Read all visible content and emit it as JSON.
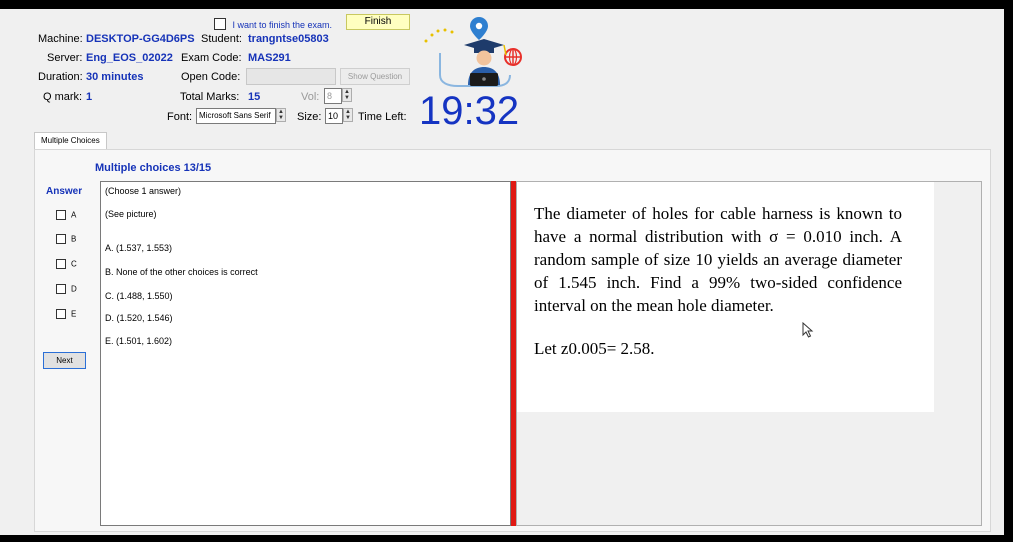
{
  "header": {
    "finish_checkbox_label": "I want to finish the exam.",
    "finish_button": "Finish",
    "machine_label": "Machine:",
    "machine_value": "DESKTOP-GG4D6PS",
    "student_label": "Student:",
    "student_value": "trangntse05803",
    "server_label": "Server:",
    "server_value": "Eng_EOS_02022",
    "exam_code_label": "Exam Code:",
    "exam_code_value": "MAS291",
    "duration_label": "Duration:",
    "duration_value": "30 minutes",
    "open_code_label": "Open Code:",
    "open_code_value": "",
    "show_question_button": "Show Question",
    "qmark_label": "Q mark:",
    "qmark_value": "1",
    "total_marks_label": "Total Marks:",
    "total_marks_value": "15",
    "vol_label": "Vol:",
    "vol_value": "8",
    "font_label": "Font:",
    "font_value": "Microsoft Sans Serif",
    "size_label": "Size:",
    "size_value": "10",
    "time_left_label": "Time Left:",
    "time_left_value": "19:32"
  },
  "tabs": {
    "active": "Multiple Choices"
  },
  "question": {
    "heading": "Multiple choices 13/15",
    "answer_label": "Answer",
    "choose_text": "(Choose 1 answer)",
    "see_picture": "(See picture)",
    "letters": [
      "A",
      "B",
      "C",
      "D",
      "E"
    ],
    "options": [
      "A. (1.537, 1.553)",
      "B. None of the other choices is correct",
      "C. (1.488, 1.550)",
      "D. (1.520, 1.546)",
      "E. (1.501, 1.602)"
    ],
    "next_button": "Next",
    "image_text": {
      "paragraph1": "The diameter of holes for cable harness is known to have a normal distribution with σ = 0.010 inch. A random sample of size 10 yields an average diameter of 1.545 inch. Find a 99% two-sided confidence interval on the mean hole diameter.",
      "paragraph2": "Let z0.005= 2.58."
    }
  },
  "colors": {
    "accent": "#1633b8",
    "timer": "#1534c2",
    "divider": "#e01a14"
  }
}
